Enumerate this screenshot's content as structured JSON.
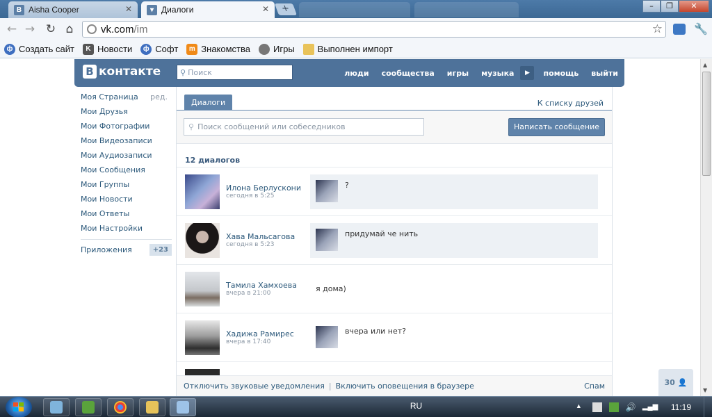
{
  "browser": {
    "tabs": [
      {
        "title": "Aisha Cooper",
        "favicon": "vk-icon",
        "active": false
      },
      {
        "title": "Диалоги",
        "favicon": "speech-bubble-icon",
        "active": true
      }
    ],
    "address": {
      "host": "vk.com",
      "path": "/im"
    },
    "bookmarks": [
      {
        "label": "Создать сайт",
        "icon": "ucoz-icon"
      },
      {
        "label": "Новости",
        "icon": "k-news-icon"
      },
      {
        "label": "Софт",
        "icon": "ucoz-icon"
      },
      {
        "label": "Знакомства",
        "icon": "mamba-icon"
      },
      {
        "label": "Игры",
        "icon": "globe-icon"
      },
      {
        "label": "Выполнен импорт",
        "icon": "folder-icon"
      }
    ]
  },
  "vk": {
    "logo": "контакте",
    "search_placeholder": "Поиск",
    "nav": [
      "люди",
      "сообщества",
      "игры",
      "музыка",
      "помощь",
      "выйти"
    ],
    "menu": [
      {
        "label": "Моя Страница",
        "extra": "ред."
      },
      {
        "label": "Мои Друзья"
      },
      {
        "label": "Мои Фотографии"
      },
      {
        "label": "Мои Видеозаписи"
      },
      {
        "label": "Мои Аудиозаписи"
      },
      {
        "label": "Мои Сообщения"
      },
      {
        "label": "Мои Группы"
      },
      {
        "label": "Мои Новости"
      },
      {
        "label": "Мои Ответы"
      },
      {
        "label": "Мои Настройки"
      }
    ],
    "apps": {
      "label": "Приложения",
      "badge": "+23"
    },
    "dialogs_tab": "Диалоги",
    "friends_link": "К списку друзей",
    "message_search_placeholder": "Поиск сообщений или собеседников",
    "write_button": "Написать сообщение",
    "dialogs_count": "12 диалогов",
    "dialogs": [
      {
        "name": "Илона Берлускони",
        "time": "сегодня в 5:25",
        "text": "?",
        "unread": true,
        "show_mini": true
      },
      {
        "name": "Хава Мальсагова",
        "time": "сегодня в 5:23",
        "text": "придумай че нить",
        "unread": true,
        "show_mini": true
      },
      {
        "name": "Тамила Хамхоева",
        "time": "вчера в 21:00",
        "text": "я дома)",
        "unread": false,
        "show_mini": false
      },
      {
        "name": "Хадижа Рамирес",
        "time": "вчера в 17:40",
        "text": "вчера или нет?",
        "unread": false,
        "show_mini": true
      }
    ],
    "bottom": {
      "sound_link": "Отключить звуковые уведомления",
      "browser_link": "Включить оповещения в браузере",
      "spam": "Спам"
    },
    "online_count": "30"
  },
  "taskbar": {
    "lang": "RU",
    "clock": "11:19"
  },
  "colors": {
    "vk_blue": "#4e729a",
    "link": "#2b587a",
    "unread_bg": "#edf1f5"
  }
}
